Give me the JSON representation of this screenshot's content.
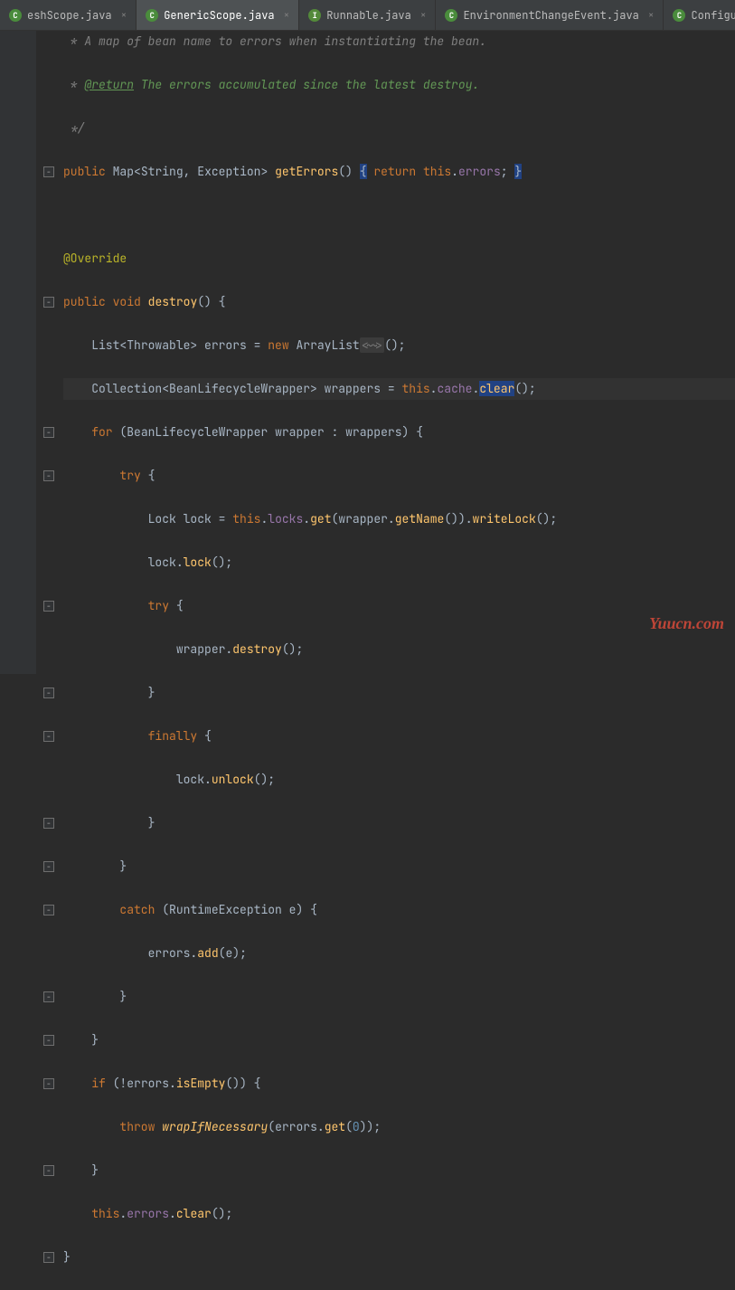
{
  "tabs": [
    {
      "label": "eshScope.java",
      "icon_class": "class",
      "icon_letter": "C",
      "active": false
    },
    {
      "label": "GenericScope.java",
      "icon_class": "class",
      "icon_letter": "C",
      "active": true
    },
    {
      "label": "Runnable.java",
      "icon_class": "interface",
      "icon_letter": "I",
      "active": false
    },
    {
      "label": "EnvironmentChangeEvent.java",
      "icon_class": "class",
      "icon_letter": "C",
      "active": false
    },
    {
      "label": "ConfigurationPro",
      "icon_class": "class",
      "icon_letter": "C",
      "active": false
    }
  ],
  "code": {
    "l1": " * A map of bean name to errors when instantiating the bean.",
    "l2a": " * ",
    "l2b": "@return",
    "l2c": " The errors accumulated since the latest destroy.",
    "l3": " */",
    "l4_public": "public",
    "l4_map": "Map",
    "l4_str": "String",
    "l4_exc": "Exception",
    "l4_get": "getErrors",
    "l4_ret": "return",
    "l4_this": "this",
    "l4_errors": "errors",
    "l6": "@Override",
    "l7_public": "public",
    "l7_void": "void",
    "l7_destroy": "destroy",
    "l8_list": "List",
    "l8_throwable": "Throwable",
    "l8_errors": "errors",
    "l8_new": "new",
    "l8_arraylist": "ArrayList",
    "l8_hint": "<~>",
    "l9_coll": "Collection",
    "l9_blw": "BeanLifecycleWrapper",
    "l9_wrappers": "wrappers",
    "l9_this": "this",
    "l9_cache": "cache",
    "l9_clear": "clear",
    "l10_for": "for",
    "l10_blw": "BeanLifecycleWrapper",
    "l10_wrapper": "wrapper",
    "l10_wrappers": "wrappers",
    "l11_try": "try",
    "l12_lock": "Lock",
    "l12_lockv": "lock",
    "l12_this": "this",
    "l12_locks": "locks",
    "l12_get": "get",
    "l12_wrapper": "wrapper",
    "l12_getname": "getName",
    "l12_writelock": "writeLock",
    "l13_lockv": "lock",
    "l13_lock": "lock",
    "l14_try": "try",
    "l15_wrapper": "wrapper",
    "l15_destroy": "destroy",
    "l17_finally": "finally",
    "l18_lockv": "lock",
    "l18_unlock": "unlock",
    "l21_catch": "catch",
    "l21_rte": "RuntimeException",
    "l21_e": "e",
    "l22_errors": "errors",
    "l22_add": "add",
    "l22_e": "e",
    "l25_if": "if",
    "l25_errors": "errors",
    "l25_isempty": "isEmpty",
    "l26_throw": "throw",
    "l26_wrap": "wrapIfNecessary",
    "l26_errors": "errors",
    "l26_get": "get",
    "l26_zero": "0",
    "l28_this": "this",
    "l28_errors": "errors",
    "l28_clear": "clear"
  },
  "watermark": "Yuucn.com",
  "fold_minus": "−"
}
